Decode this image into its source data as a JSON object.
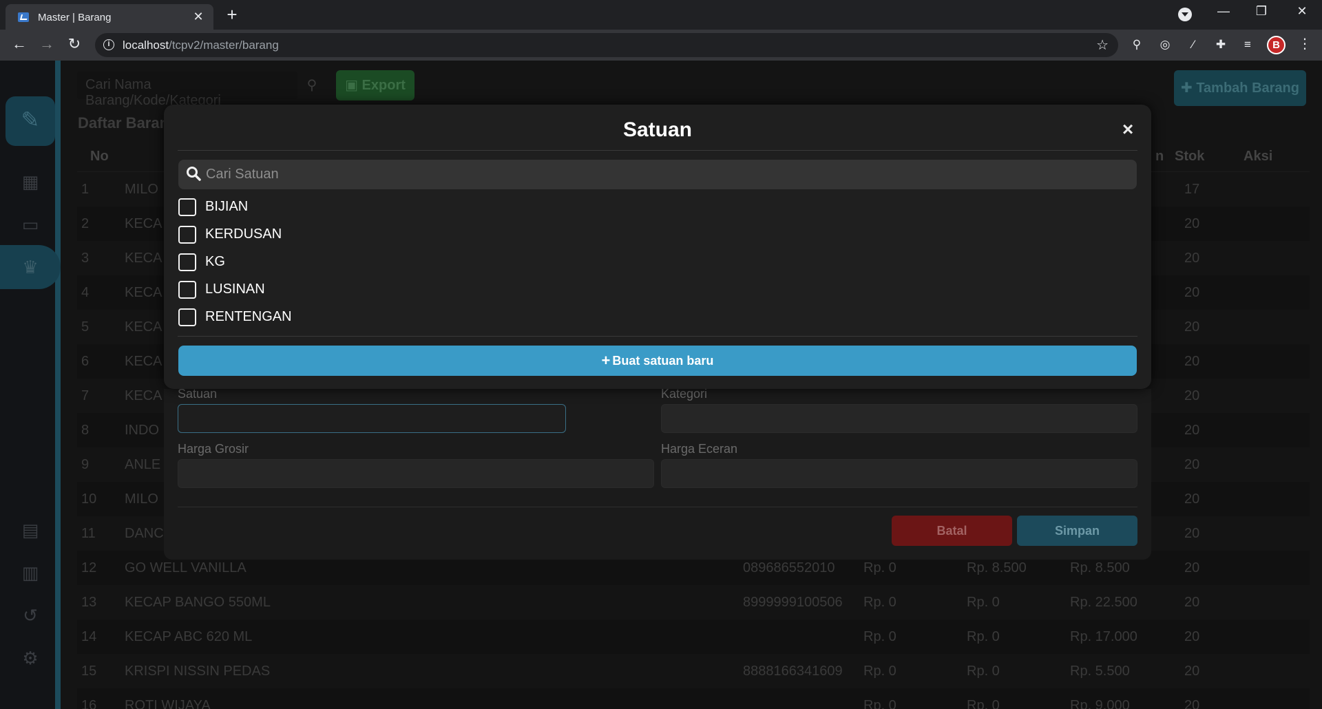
{
  "browser": {
    "tab_title": "Master | Barang",
    "url_host": "localhost",
    "url_path": "/tcpv2/master/barang",
    "avatar_letter": "B"
  },
  "page": {
    "search_placeholder": "Cari Nama Barang/Kode/Kategori",
    "export_label": "Export",
    "add_label": "Tambah Barang",
    "list_title": "Daftar Barang",
    "columns": [
      "No",
      "Stok",
      "Aksi"
    ],
    "partial_header": "n",
    "rows": [
      {
        "no": "1",
        "name": "MILO",
        "code": "",
        "p1": "",
        "p2": "",
        "p3": "",
        "stok": "17"
      },
      {
        "no": "2",
        "name": "KECA",
        "code": "",
        "p1": "",
        "p2": "",
        "p3": "",
        "stok": "20"
      },
      {
        "no": "3",
        "name": "KECA",
        "code": "",
        "p1": "",
        "p2": "",
        "p3": "",
        "stok": "20"
      },
      {
        "no": "4",
        "name": "KECA",
        "code": "",
        "p1": "",
        "p2": "",
        "p3": "",
        "stok": "20"
      },
      {
        "no": "5",
        "name": "KECA",
        "code": "",
        "p1": "",
        "p2": "",
        "p3": "",
        "stok": "20"
      },
      {
        "no": "6",
        "name": "KECA",
        "code": "",
        "p1": "",
        "p2": "",
        "p3": "",
        "stok": "20"
      },
      {
        "no": "7",
        "name": "KECA",
        "code": "",
        "p1": "",
        "p2": "",
        "p3": "",
        "stok": "20"
      },
      {
        "no": "8",
        "name": "INDO",
        "code": "",
        "p1": "",
        "p2": "",
        "p3": "",
        "stok": "20"
      },
      {
        "no": "9",
        "name": "ANLE",
        "code": "",
        "p1": "",
        "p2": "",
        "p3": "",
        "stok": "20"
      },
      {
        "no": "10",
        "name": "MILO",
        "code": "",
        "p1": "",
        "p2": "",
        "p3": "",
        "stok": "20"
      },
      {
        "no": "11",
        "name": "DANC",
        "code": "",
        "p1": "",
        "p2": "",
        "p3": "",
        "stok": "20"
      },
      {
        "no": "12",
        "name": "GO WELL VANILLA",
        "code": "089686552010",
        "p1": "Rp. 0",
        "p2": "Rp. 8.500",
        "p3": "Rp. 8.500",
        "stok": "20"
      },
      {
        "no": "13",
        "name": "KECAP BANGO 550ML",
        "code": "8999999100506",
        "p1": "Rp. 0",
        "p2": "Rp. 0",
        "p3": "Rp. 22.500",
        "stok": "20"
      },
      {
        "no": "14",
        "name": "KECAP ABC 620 ML",
        "code": "",
        "p1": "Rp. 0",
        "p2": "Rp. 0",
        "p3": "Rp. 17.000",
        "stok": "20"
      },
      {
        "no": "15",
        "name": "KRISPI NISSIN PEDAS",
        "code": "8888166341609",
        "p1": "Rp. 0",
        "p2": "Rp. 0",
        "p3": "Rp. 5.500",
        "stok": "20"
      },
      {
        "no": "16",
        "name": "ROTI WIJAYA",
        "code": "",
        "p1": "Rp. 0",
        "p2": "Rp. 0",
        "p3": "Rp. 9.000",
        "stok": "20"
      }
    ]
  },
  "form": {
    "satuan_label": "Satuan",
    "kategori_label": "Kategori",
    "harga_grosir_label": "Harga Grosir",
    "harga_eceran_label": "Harga Eceran",
    "batal_label": "Batal",
    "simpan_label": "Simpan"
  },
  "modal": {
    "title": "Satuan",
    "close_glyph": "×",
    "search_placeholder": "Cari Satuan",
    "options": [
      "BIJIAN",
      "KERDUSAN",
      "KG",
      "LUSINAN",
      "RENTENGAN"
    ],
    "create_label": "Buat satuan baru"
  },
  "colors": {
    "accent": "#3a9bc7",
    "danger": "#6b1515",
    "success": "#1b4b24"
  }
}
